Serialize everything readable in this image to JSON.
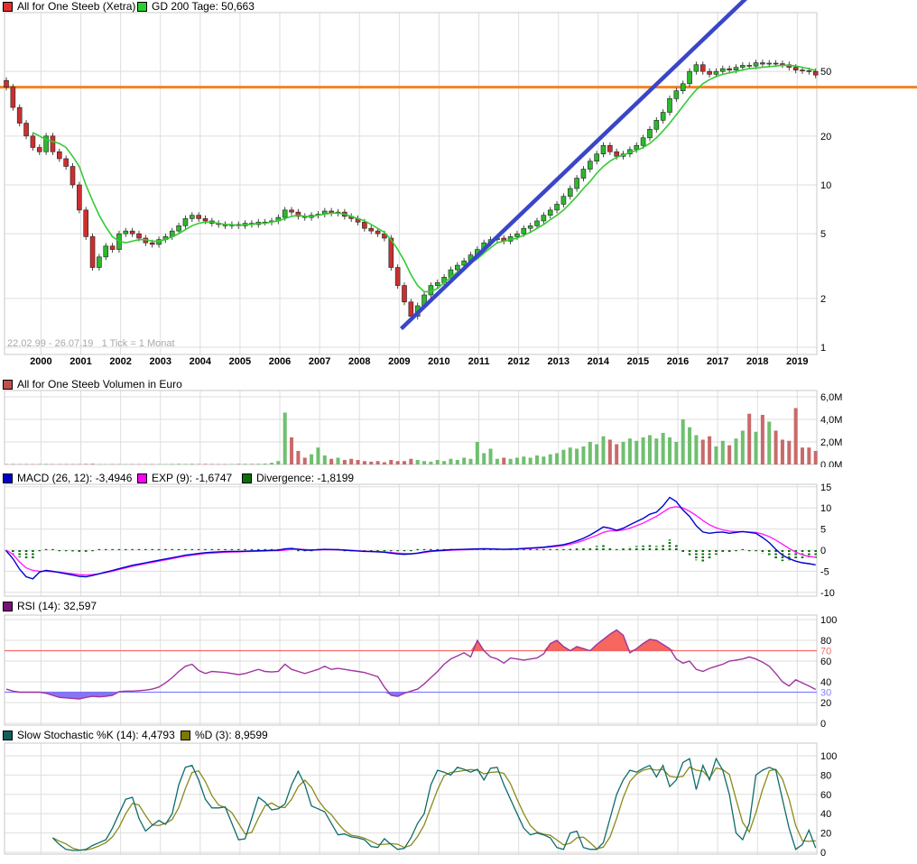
{
  "legend": {
    "price": "All for One Steeb (Xetra)",
    "gd": "GD 200 Tage: 50,663",
    "volume": "All for One Steeb Volumen in Euro",
    "macd": "MACD (26, 12): -3,4946",
    "exp": "EXP (9): -1,6747",
    "div": "Divergence: -1,8199",
    "rsi": "RSI (14): 32,597",
    "k": "Slow Stochastic %K (14): 4,4793",
    "d": "%D (3): 8,9599"
  },
  "note": "22.02.99 - 26.07.19   1 Tick = 1 Monat",
  "colors": {
    "up": "#2db82d",
    "down": "#cc2f2f",
    "wick": "#333333",
    "gd": "#33cc33",
    "trend": "#3a46c8",
    "hline": "#f58220",
    "grid": "#dedede",
    "border": "#c8c8c8",
    "vol_up": "#6fbf6f",
    "vol_down": "#c96a6a",
    "macd": "#0000cc",
    "exp": "#ff22ff",
    "div": "#0a6e0a",
    "rsi": "#a0359f",
    "rsi_hi_fill": "#f4564e",
    "rsi_lo_fill": "#7a66f0",
    "k": "#0f6b6b",
    "d": "#8a8a1a",
    "sw_price": "#e03131",
    "sw_gd": "#2dce2d",
    "sw_vol": "#c0504d",
    "sw_macd": "#0000cc",
    "sw_exp": "#ff00ff",
    "sw_div": "#0a6e0a",
    "sw_rsi": "#7a0f7a",
    "sw_k": "#0f5f5f",
    "sw_d": "#7a7a00"
  },
  "chart_data": {
    "type": "candlestick+indicators",
    "x_start": "1999-02",
    "x_step_months": 2,
    "years": [
      "2000",
      "2001",
      "2002",
      "2003",
      "2004",
      "2005",
      "2006",
      "2007",
      "2008",
      "2009",
      "2010",
      "2011",
      "2012",
      "2013",
      "2014",
      "2015",
      "2016",
      "2017",
      "2018",
      "2019"
    ],
    "price_grid": [
      1,
      2,
      5,
      10,
      20,
      50
    ],
    "price_axis": [
      {
        "v": 50,
        "t": "50"
      },
      {
        "v": 20,
        "t": "20"
      },
      {
        "v": 10,
        "t": "10"
      },
      {
        "v": 5,
        "t": "5"
      },
      {
        "v": 2,
        "t": "2"
      },
      {
        "v": 1,
        "t": "1"
      }
    ],
    "hline": 40,
    "trend": {
      "x1_year": 2009.05,
      "price1": 1.3,
      "x2_year": 2017.95,
      "price2": 160
    },
    "close": [
      40,
      30,
      24,
      20,
      17,
      16,
      20,
      16,
      14.5,
      13,
      10,
      7,
      4.8,
      3.1,
      3.6,
      4.2,
      4,
      5,
      5.2,
      5,
      4.7,
      4.4,
      4.3,
      4.6,
      4.8,
      5.2,
      5.6,
      6.2,
      6.5,
      6.2,
      6,
      5.8,
      5.7,
      5.6,
      5.7,
      5.6,
      5.8,
      5.7,
      5.9,
      5.9,
      6,
      6.3,
      7,
      6.8,
      6.4,
      6.3,
      6.5,
      6.6,
      6.9,
      6.7,
      6.8,
      6.4,
      6.2,
      5.9,
      5.4,
      5.2,
      5,
      4.7,
      3.1,
      2.4,
      1.9,
      1.55,
      1.8,
      2.1,
      2.4,
      2.5,
      2.7,
      3,
      3.2,
      3.4,
      3.7,
      4,
      4.4,
      4.6,
      4.7,
      4.5,
      4.8,
      5,
      5.4,
      5.6,
      6,
      6.5,
      7,
      7.6,
      8.5,
      9.5,
      11,
      12.5,
      14,
      15.5,
      17.5,
      16,
      15,
      15.5,
      16.5,
      17.5,
      19.5,
      22,
      25,
      28,
      34,
      38,
      42,
      50,
      55,
      50,
      48,
      50,
      52,
      51,
      53,
      54.5,
      54,
      56.5,
      55.5,
      56.2,
      55.8,
      55,
      53,
      51,
      50.5,
      50,
      47.5
    ],
    "gd200": [
      null,
      null,
      null,
      null,
      21,
      20,
      19,
      18.5,
      18,
      17,
      15,
      13,
      10,
      8,
      6.5,
      5.5,
      4.8,
      4.5,
      4.4,
      4.5,
      4.6,
      4.6,
      4.5,
      4.5,
      4.6,
      4.8,
      5,
      5.3,
      5.6,
      5.8,
      5.9,
      5.9,
      5.8,
      5.7,
      5.7,
      5.6,
      5.7,
      5.7,
      5.8,
      5.8,
      5.9,
      6,
      6.2,
      6.4,
      6.5,
      6.4,
      6.4,
      6.5,
      6.6,
      6.7,
      6.7,
      6.6,
      6.4,
      6.2,
      6,
      5.7,
      5.4,
      5.1,
      4.6,
      4,
      3.4,
      2.8,
      2.4,
      2.2,
      2.2,
      2.3,
      2.5,
      2.7,
      2.9,
      3.1,
      3.3,
      3.5,
      3.8,
      4.1,
      4.4,
      4.5,
      4.6,
      4.7,
      4.9,
      5.1,
      5.4,
      5.7,
      6.1,
      6.5,
      7,
      7.7,
      8.5,
      9.5,
      10.5,
      11.8,
      13,
      14,
      14.8,
      15.3,
      15.8,
      16.3,
      17,
      18,
      19.5,
      21.5,
      24,
      27,
      30.5,
      34.5,
      38.5,
      42,
      44.5,
      46.5,
      48,
      49,
      50,
      51,
      52,
      52.5,
      53,
      53.5,
      54,
      54.5,
      54.5,
      54,
      53,
      52,
      50.66
    ],
    "volume_millions": [
      0.03,
      0.04,
      0.03,
      0.02,
      0.02,
      0.03,
      0.05,
      0.03,
      0.02,
      0.02,
      0.03,
      0.04,
      0.05,
      0.06,
      0.04,
      0.03,
      0.03,
      0.04,
      0.03,
      0.02,
      0.02,
      0.02,
      0.03,
      0.03,
      0.04,
      0.05,
      0.06,
      0.05,
      0.06,
      0.04,
      0.05,
      0.04,
      0.03,
      0.03,
      0.04,
      0.05,
      0.06,
      0.05,
      0.06,
      0.08,
      0.15,
      0.3,
      4.6,
      2.4,
      1.2,
      0.6,
      0.9,
      1.5,
      0.8,
      0.5,
      0.6,
      0.4,
      0.5,
      0.4,
      0.3,
      0.25,
      0.3,
      0.2,
      0.4,
      0.3,
      0.3,
      0.5,
      0.4,
      0.3,
      0.25,
      0.4,
      0.3,
      0.5,
      0.4,
      0.6,
      0.5,
      2.0,
      1.0,
      1.4,
      0.5,
      0.6,
      0.5,
      0.6,
      0.7,
      0.6,
      0.8,
      0.7,
      0.9,
      1.0,
      1.3,
      1.5,
      1.4,
      1.6,
      2.0,
      1.8,
      2.5,
      2.2,
      1.8,
      2.0,
      2.3,
      2.1,
      2.4,
      2.6,
      2.3,
      2.8,
      2.4,
      2.0,
      4.0,
      3.3,
      2.6,
      2.2,
      2.5,
      1.6,
      2.1,
      1.7,
      2.3,
      3.0,
      4.5,
      2.9,
      4.4,
      3.8,
      3.0,
      2.2,
      2.1,
      5.0,
      1.5,
      1.5,
      1.2
    ],
    "vol_grid": [
      2,
      4,
      6
    ],
    "vol_axis": [
      {
        "v": 6,
        "t": "6,0M"
      },
      {
        "v": 4,
        "t": "4,0M"
      },
      {
        "v": 2,
        "t": "2,0M"
      },
      {
        "v": 0,
        "t": "0,0M"
      }
    ],
    "macd": [
      -0.2,
      -2,
      -4.5,
      -6.3,
      -6.8,
      -5.2,
      -4.8,
      -5,
      -5.3,
      -5.6,
      -5.9,
      -6.2,
      -6.3,
      -6,
      -5.6,
      -5.2,
      -4.8,
      -4.4,
      -4,
      -3.6,
      -3.3,
      -3,
      -2.7,
      -2.4,
      -2.1,
      -1.8,
      -1.5,
      -1.2,
      -1,
      -0.8,
      -0.6,
      -0.5,
      -0.4,
      -0.35,
      -0.3,
      -0.3,
      -0.25,
      -0.2,
      -0.15,
      -0.1,
      -0.05,
      0,
      0.3,
      0.4,
      0.2,
      0,
      0,
      0.1,
      0.2,
      0.15,
      0.1,
      0,
      -0.1,
      -0.2,
      -0.3,
      -0.35,
      -0.4,
      -0.5,
      -0.7,
      -0.9,
      -1,
      -0.9,
      -0.7,
      -0.4,
      -0.2,
      -0.1,
      0,
      0.1,
      0.15,
      0.2,
      0.25,
      0.3,
      0.35,
      0.3,
      0.25,
      0.2,
      0.25,
      0.3,
      0.4,
      0.5,
      0.6,
      0.7,
      0.9,
      1.1,
      1.3,
      1.7,
      2.2,
      2.8,
      3.6,
      4.5,
      5.5,
      5.2,
      4.7,
      5.2,
      6,
      6.8,
      7.5,
      8.5,
      9,
      10.5,
      12.5,
      11.5,
      9.5,
      8,
      5.8,
      4.3,
      4,
      4.2,
      4.3,
      4,
      4.2,
      4.4,
      4.2,
      4,
      3,
      1.8,
      0.2,
      -1.2,
      -2,
      -2.6,
      -3,
      -3.2,
      -3.49
    ],
    "exp": [
      0,
      -1,
      -2.8,
      -4.2,
      -4.8,
      -5,
      -5,
      -5.1,
      -5.2,
      -5.4,
      -5.6,
      -5.8,
      -5.9,
      -5.8,
      -5.6,
      -5.3,
      -5,
      -4.6,
      -4.2,
      -3.8,
      -3.5,
      -3.2,
      -2.9,
      -2.6,
      -2.3,
      -2,
      -1.7,
      -1.4,
      -1.2,
      -1,
      -0.8,
      -0.7,
      -0.6,
      -0.5,
      -0.45,
      -0.4,
      -0.35,
      -0.3,
      -0.25,
      -0.2,
      -0.15,
      -0.1,
      0,
      0.2,
      0.25,
      0.15,
      0.05,
      0.05,
      0.1,
      0.12,
      0.1,
      0.05,
      -0.05,
      -0.15,
      -0.25,
      -0.3,
      -0.35,
      -0.4,
      -0.55,
      -0.7,
      -0.8,
      -0.85,
      -0.75,
      -0.55,
      -0.35,
      -0.2,
      -0.1,
      0,
      0.05,
      0.1,
      0.15,
      0.2,
      0.25,
      0.25,
      0.2,
      0.18,
      0.2,
      0.25,
      0.3,
      0.4,
      0.5,
      0.6,
      0.75,
      0.9,
      1.1,
      1.4,
      1.8,
      2.3,
      2.9,
      3.5,
      4.2,
      4.6,
      4.6,
      4.8,
      5.2,
      5.8,
      6.4,
      7.2,
      8,
      9,
      10,
      10.3,
      10,
      9.2,
      8.2,
      7,
      6,
      5.3,
      4.8,
      4.5,
      4.4,
      4.4,
      4.3,
      4.2,
      3.8,
      3.2,
      2.4,
      1.4,
      0.4,
      -0.5,
      -1.1,
      -1.5,
      -1.67
    ],
    "macd_grid": [
      15,
      10,
      5,
      0,
      -5,
      -10
    ],
    "macd_axis": [
      {
        "v": 15,
        "t": "15"
      },
      {
        "v": 10,
        "t": "10"
      },
      {
        "v": 5,
        "t": "5"
      },
      {
        "v": 0,
        "t": "0"
      },
      {
        "v": -5,
        "t": "-5"
      },
      {
        "v": -10,
        "t": "-10"
      }
    ],
    "rsi": [
      33,
      31,
      30,
      30,
      30,
      30,
      29,
      27,
      25,
      24.5,
      24,
      23.5,
      25,
      26,
      25.5,
      26,
      27,
      30.5,
      31,
      31,
      31.5,
      32,
      33,
      35,
      39,
      44,
      50,
      55,
      57,
      51,
      48,
      50,
      49.5,
      49,
      48,
      47,
      48,
      50,
      52,
      50,
      49.5,
      50,
      57,
      52,
      50,
      48,
      50,
      52,
      55,
      52,
      53,
      52,
      51,
      50,
      49,
      47,
      45,
      35,
      27,
      26,
      29,
      31,
      33,
      38,
      44,
      50,
      57,
      62,
      65,
      68,
      64,
      80,
      70,
      64,
      62,
      58,
      63,
      62,
      61,
      62,
      63,
      67,
      77,
      80,
      74,
      70,
      74,
      72,
      70,
      76,
      81,
      86,
      90,
      85,
      68,
      72,
      77,
      81,
      80,
      76,
      72,
      62,
      58,
      60,
      52,
      50,
      53,
      55,
      57,
      60,
      61,
      62,
      64,
      62,
      59,
      55,
      48,
      40,
      36,
      42,
      39,
      36,
      32.6
    ],
    "rsi_grid": [
      100,
      80,
      60,
      40,
      20,
      0
    ],
    "rsi_axis": [
      {
        "v": 100,
        "t": "100"
      },
      {
        "v": 80,
        "t": "80"
      },
      {
        "v": 70,
        "t": "70",
        "c": "#f46a6a"
      },
      {
        "v": 60,
        "t": "60"
      },
      {
        "v": 40,
        "t": "40"
      },
      {
        "v": 30,
        "t": "30",
        "c": "#8080ff"
      },
      {
        "v": 20,
        "t": "20"
      },
      {
        "v": 0,
        "t": "0"
      }
    ],
    "rsi_lines": [
      {
        "v": 70,
        "c": "#f46a6a"
      },
      {
        "v": 30,
        "c": "#8080ff"
      }
    ],
    "rsi_overbought": 70,
    "rsi_oversold": 30,
    "stoch_k": [
      null,
      null,
      null,
      null,
      null,
      null,
      null,
      15,
      8,
      3,
      2,
      2,
      3,
      7,
      10,
      13,
      25,
      40,
      55,
      57,
      35,
      22,
      28,
      33,
      29,
      40,
      70,
      88,
      90,
      75,
      55,
      46,
      46,
      47,
      30,
      13,
      14,
      35,
      57,
      52,
      44,
      45,
      50,
      70,
      84,
      70,
      48,
      45,
      42,
      30,
      18,
      19,
      16,
      15,
      13,
      6,
      5,
      14,
      8,
      3,
      4,
      15,
      30,
      40,
      70,
      85,
      83,
      80,
      88,
      86,
      83,
      86,
      75,
      87,
      88,
      70,
      55,
      40,
      25,
      18,
      20,
      18,
      15,
      5,
      3,
      20,
      22,
      5,
      3,
      3,
      10,
      35,
      60,
      75,
      85,
      83,
      87,
      90,
      78,
      90,
      68,
      75,
      93,
      97,
      65,
      90,
      75,
      97,
      85,
      60,
      20,
      13,
      30,
      80,
      85,
      88,
      85,
      55,
      25,
      3,
      8,
      23,
      4.5
    ],
    "stoch_grid": [
      100,
      80,
      60,
      40,
      20,
      0
    ],
    "stoch_axis": [
      {
        "v": 100,
        "t": "100"
      },
      {
        "v": 80,
        "t": "80"
      },
      {
        "v": 60,
        "t": "60"
      },
      {
        "v": 40,
        "t": "40"
      },
      {
        "v": 20,
        "t": "20"
      },
      {
        "v": 0,
        "t": "0"
      }
    ]
  }
}
